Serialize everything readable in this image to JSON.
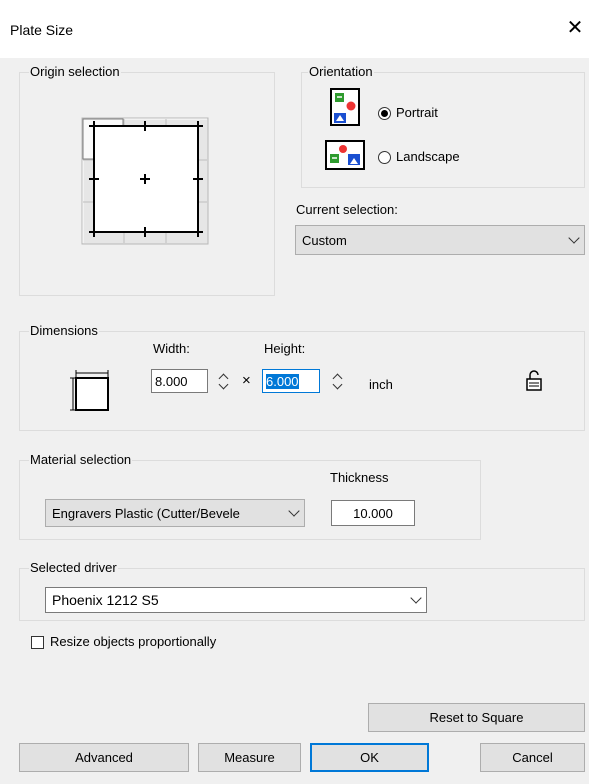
{
  "window": {
    "title": "Plate Size",
    "close_glyph": "✕"
  },
  "origin": {
    "label": "Origin selection"
  },
  "orientation": {
    "label": "Orientation",
    "portrait_label": "Portrait",
    "landscape_label": "Landscape",
    "selected": "Portrait"
  },
  "current_selection": {
    "label": "Current selection:",
    "value": "Custom"
  },
  "dimensions": {
    "label": "Dimensions",
    "width_label": "Width:",
    "height_label": "Height:",
    "width_value": "8.000",
    "height_value": "6.000",
    "times": "×",
    "unit": "inch"
  },
  "material": {
    "label": "Material selection",
    "value": "Engravers Plastic (Cutter/Bevele",
    "thickness_label": "Thickness",
    "thickness_value": "10.000"
  },
  "driver": {
    "label": "Selected driver",
    "value": "Phoenix 1212 S5"
  },
  "resize": {
    "label": "Resize objects proportionally",
    "checked": false
  },
  "buttons": {
    "reset": "Reset to Square",
    "advanced": "Advanced",
    "measure": "Measure",
    "ok": "OK",
    "cancel": "Cancel"
  },
  "colors": {
    "accent": "#0078d7",
    "selection": "#0078d7"
  }
}
